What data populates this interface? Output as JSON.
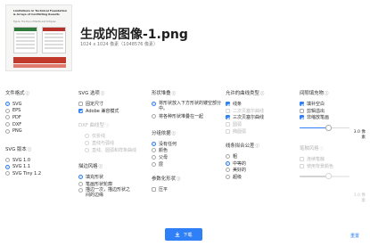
{
  "preview": {
    "title": "Limitations in Technical Foundation & Arrays of Conflicting Results",
    "subtitle": "Figure: The Tone of Merits and Critiques"
  },
  "file": {
    "name": "生成的图像-1.png",
    "meta": "1024 x 1024 像素（1048576 像素）"
  },
  "format": {
    "label": "文件格式",
    "options": [
      "SVG",
      "EPS",
      "PDF",
      "DXF",
      "PNG"
    ]
  },
  "svg_version": {
    "label": "SVG 版本",
    "options": [
      "SVG 1.0",
      "SVG 1.1",
      "SVG Tiny 1.2"
    ]
  },
  "svg_options": {
    "label": "SVG 选项",
    "items": [
      "固定尺寸",
      "Adobe 兼容模式"
    ]
  },
  "dxf": {
    "label": "DXF 曲线型",
    "options": [
      "仅折线",
      "直线与弧线",
      "直线、圆弧和样条曲线"
    ]
  },
  "stroke": {
    "label": "描边风格",
    "options": [
      "填充形状",
      "笔画形状轮廓",
      "描边一次，描边形状之间的边缘"
    ]
  },
  "shape_stack": {
    "label": "形状堆叠",
    "options": [
      "将形状放入下方形状的镂空部分中。",
      "将各种形状堆叠在一起"
    ]
  },
  "group_by": {
    "label": "分组依据",
    "options": [
      "没有任何",
      "颜色",
      "父母",
      "层"
    ]
  },
  "params": {
    "label": "参数化形状",
    "items": [
      "压平"
    ]
  },
  "curves": {
    "label": "允许的曲线类型",
    "items": [
      "线条",
      "二次贝塞尔曲线",
      "三次贝塞尔曲线",
      "圆弧",
      "椭圆弧"
    ]
  },
  "fit": {
    "label": "线条拟合公差",
    "options": [
      "粗",
      "中等的",
      "美好的",
      "超级"
    ]
  },
  "gap": {
    "label": "间隙填充物",
    "items": [
      "填补空白",
      "剪辑溢出",
      "非缩放笔画"
    ],
    "width_value": "3.0 像素"
  },
  "bg": {
    "label": "笔触风格",
    "items": [
      "连续笔触",
      "使用背景颜色"
    ],
    "width_value": "3.0 像素"
  },
  "sliders": {
    "gap_level": 0.58,
    "bg_level": 0.58
  },
  "footer": {
    "download": "下载",
    "reset": "重置"
  },
  "colors": {
    "accent": "#2f7ff6"
  }
}
